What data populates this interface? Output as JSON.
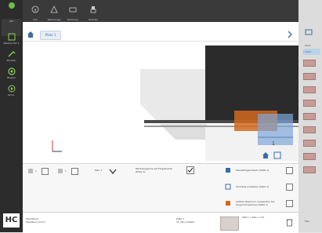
{
  "sidebar": {
    "items": [
      {
        "label": "API",
        "icon": "app-icon"
      },
      {
        "label": "Weitere Teil 1",
        "icon": "pages-icon"
      },
      {
        "label": "Einstell.",
        "icon": "wrench-icon"
      },
      {
        "label": "Biegen",
        "icon": "bend-icon"
      },
      {
        "label": "Simul.",
        "icon": "play-icon"
      }
    ],
    "logo": "HC"
  },
  "toolbar": {
    "buttons": [
      {
        "label": "Info"
      },
      {
        "label": "Werkzeuge"
      },
      {
        "label": "Stationen"
      },
      {
        "label": "Roboter"
      }
    ]
  },
  "breadcrumb": {
    "tab_label": "Platz 1"
  },
  "canvas": {
    "station_number": "1"
  },
  "options": {
    "field1_value": "1",
    "field2_value": "1",
    "field3_label": "Plan 1",
    "tool_side_label": "Werkzeugsorte auf Fingerbeide (Platz 1)",
    "right_items": [
      "Planabfolgeumkehr (Platz 1)",
      "Vorbiede einstellen (Platz 1)",
      "Letzten Reservoir verwenden bei Programmwechsel (Platz 1)"
    ]
  },
  "status": {
    "left_text": "Werkstück: Stahlblech 2mm",
    "middle_text": "Platz 1\n31_MS 1234abc",
    "right_text": "089.1 x 960.1 x 97"
  },
  "right_strip": {
    "header": "Palet",
    "selected": "1 Platz",
    "footer": "Plan",
    "swatch_count": 9
  },
  "colors": {
    "accent": "#3a6ea5",
    "orange": "#d2691e",
    "blue_box": "#7fa6d9",
    "dark_panel": "#2c2c2c"
  }
}
